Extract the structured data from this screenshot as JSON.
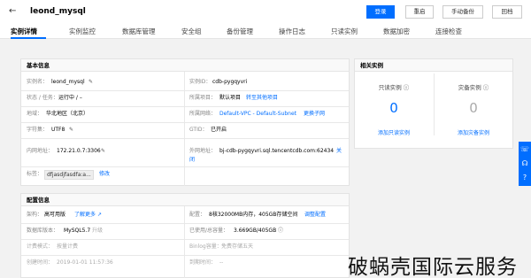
{
  "header": {
    "back_icon": "←",
    "title": "leond_mysql",
    "buttons": {
      "login": "登录",
      "restart": "重启",
      "manual_backup": "手动备份",
      "rollback": "回档"
    }
  },
  "tabs": [
    "实例详情",
    "实例监控",
    "数据库管理",
    "安全组",
    "备份管理",
    "操作日志",
    "只读实例",
    "数据加密",
    "连接检查"
  ],
  "basic": {
    "heading": "基本信息",
    "name_label": "实例名：",
    "name_value": "leond_mysql",
    "id_label": "实例ID：",
    "id_value": "cdb-pygqyvri",
    "status_label": "状态 / 任务：",
    "status_value": "运行中 / –",
    "project_label": "所属项目：",
    "project_value": "默认项目",
    "project_link": "转至其他项目",
    "region_label": "地域：",
    "region_value": "华北地区（北京）",
    "network_label": "所属网络：",
    "network_value": "Default-VPC - Default-Subnet",
    "network_link": "更换子网",
    "charset_label": "字符集：",
    "charset_value": "UTF8",
    "gtid_label": "GTID：",
    "gtid_value": "已开启",
    "intranet_label": "内网地址：",
    "intranet_value": "172.21.0.7:3306",
    "extranet_label": "外网地址：",
    "extranet_value": "bj-cdb-pygqyvri.sql.tencentcdb.com:62434",
    "extranet_link1": "关",
    "extranet_link2": "闭",
    "tags_label": "标签：",
    "tags_value": "dfjasdjfasdfa:a...",
    "tags_link": "修改"
  },
  "config": {
    "heading": "配置信息",
    "arch_label": "架构：",
    "arch_value": "高可用版",
    "arch_link": "了解更多",
    "spec_label": "配置：",
    "spec_value": "8核32000MB内存，405GB存储空间",
    "spec_link": "调整配置",
    "version_label": "数据库版本：",
    "version_value": "MySQL5.7",
    "version_link": "升级",
    "usage_label": "已使用/总容量：",
    "usage_value": "3.669GB/405GB",
    "billing_label": "计费模式：",
    "billing_value": "按量计费",
    "binlog_label": "Binlog容量：",
    "binlog_value": "免费存储五天",
    "created_label": "创建时间：",
    "created_value": "2019-01-01 11:57:36",
    "expire_label": "到期时间：",
    "expire_value": "--"
  },
  "related": {
    "heading": "相关实例",
    "readonly_label": "只读实例",
    "readonly_count": "0",
    "readonly_link": "添加只读实例",
    "disaster_label": "灾备实例",
    "disaster_count": "0",
    "disaster_link": "添加灾备实例"
  },
  "icons": {
    "edit": "✎",
    "info": "ⓘ",
    "external": "↗",
    "help": "?",
    "phone": "☏",
    "headset": "☊"
  },
  "watermark": "破蜗壳国际云服务",
  "colors": {
    "primary": "#006eff",
    "text": "#333333",
    "muted": "#888888"
  }
}
